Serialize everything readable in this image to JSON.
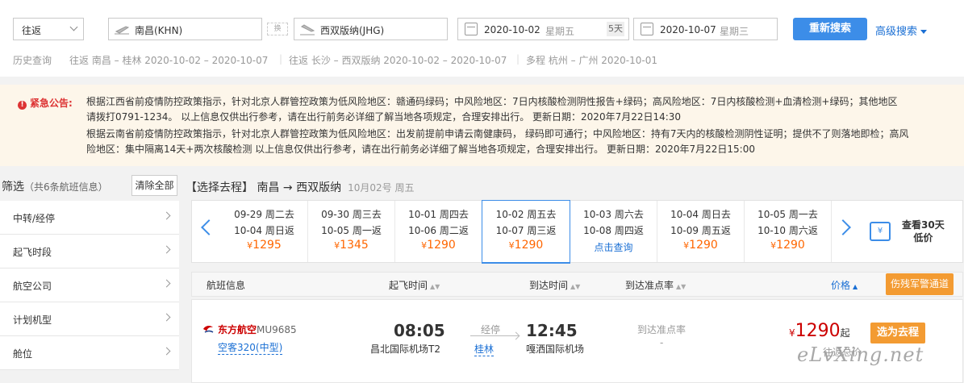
{
  "search": {
    "trip_type": "往返",
    "from_city": "南昌(KHN)",
    "swap_label": "换",
    "to_city": "西双版纳(JHG)",
    "depart_date": "2020-10-02",
    "depart_weekday": "星期五",
    "days_label": "5天",
    "return_date": "2020-10-07",
    "return_weekday": "星期三",
    "search_button": "重新搜索",
    "advanced_search": "高级搜索"
  },
  "history": {
    "label": "历史查询",
    "items": [
      "往返 南昌 – 桂林  2020-10-02 – 2020-10-07",
      "往返 长沙 – 西双版纳  2020-10-02 – 2020-10-07",
      "多程 杭州 – 广州  2020-10-01"
    ]
  },
  "notice": {
    "title": "紧急公告:",
    "icon_text": "!",
    "p1_line1": "根据江西省前疫情防控政策指示，针对北京人群管控政策为低风险地区：赣通码绿码；中风险地区：7日内核酸检测阴性报告+绿码；高风险地区：7日内核酸检测+血清检测+绿码；其他地区",
    "p1_line2": "请拨打0791-1234。 以上信息仅供出行参考，请在出行前务必详细了解当地各项规定，合理安排出行。 更新日期：2020年7月22日14:30",
    "p2_line1": "根据云南省前疫情防控政策指示，针对北京人群管控政策为低风险地区：出发前提前申请云南健康码， 绿码即可通行；中风险地区：持有7天内的核酸检测阴性证明；提供不了则落地即检；高风",
    "p2_line2": "险地区：集中隔离14天+两次核酸检测 以上信息仅供出行参考，请在出行前务必详细了解当地各项规定，合理安排出行。 更新日期：2020年7月22日15:00"
  },
  "filter": {
    "title": "筛选",
    "count": "（共6条航班信息）",
    "clear_all": "清除全部",
    "items": [
      "中转/经停",
      "起飞时段",
      "航空公司",
      "计划机型",
      "舱位"
    ]
  },
  "route": {
    "title": "【选择去程】 南昌 → 西双版纳",
    "date": "10月02号 周五"
  },
  "date_strip": [
    {
      "depart": "09-29 周二去",
      "return": "10-04 周日返",
      "currency": "¥",
      "price": "1295"
    },
    {
      "depart": "09-30 周三去",
      "return": "10-05 周一返",
      "currency": "¥",
      "price": "1345"
    },
    {
      "depart": "10-01 周四去",
      "return": "10-06 周二返",
      "currency": "¥",
      "price": "1290"
    },
    {
      "depart": "10-02 周五去",
      "return": "10-07 周三返",
      "currency": "¥",
      "price": "1290"
    },
    {
      "depart": "10-03 周六去",
      "return": "10-08 周四返",
      "currency": "",
      "price": "",
      "query": "点击查询"
    },
    {
      "depart": "10-04 周日去",
      "return": "10-09 周五返",
      "currency": "¥",
      "price": "1290"
    },
    {
      "depart": "10-05 周一去",
      "return": "10-10 周六返",
      "currency": "¥",
      "price": "1290"
    }
  ],
  "cal30": {
    "icon_text": "¥",
    "line1": "查看30天",
    "line2": "低价"
  },
  "table_head": {
    "flight_info": "航班信息",
    "depart_time": "起飞时间",
    "arrive_time": "到达时间",
    "ontime_rate": "到达准点率",
    "price": "价格",
    "military": "伤残军警通道"
  },
  "flight": {
    "airline": "东方航空",
    "flight_no": "MU9685",
    "aircraft": "空客320(中型)",
    "depart_time": "08:05",
    "depart_airport": "昌北国际机场T2",
    "stop_label": "经停",
    "stop_city": "桂林",
    "arrive_time": "12:45",
    "arrive_airport": "嘎洒国际机场",
    "ontime_label": "到达准点率",
    "ontime_value": "-",
    "currency": "¥",
    "price": "1290",
    "price_suffix": "起",
    "price_sub": "往返总价",
    "choose_button": "选为去程"
  },
  "watermark": "eLvXing.net",
  "colors": {
    "accent": "#3c8de8",
    "price": "#ff6600",
    "orange": "#f39b32",
    "airline_red": "#cc0000"
  }
}
